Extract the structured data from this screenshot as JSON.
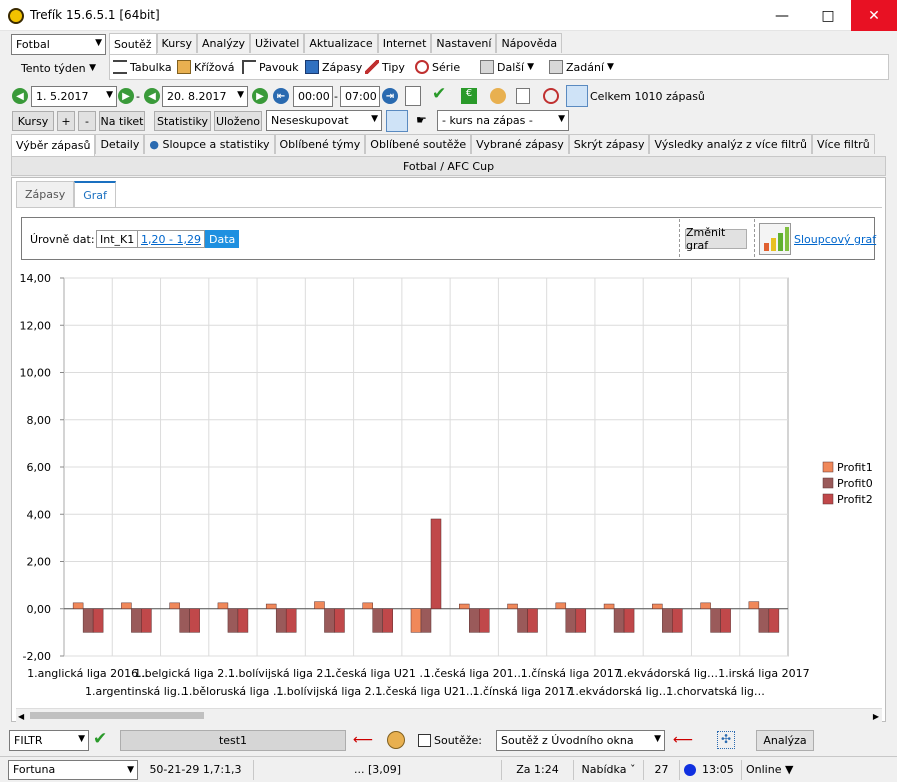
{
  "window": {
    "title": "Trefík 15.6.5.1 [64bit]"
  },
  "top": {
    "sport": "Fotbal",
    "period": "Tento týden",
    "menu_tabs": [
      "Soutěž",
      "Kursy",
      "Analýzy",
      "Uživatel",
      "Aktualizace",
      "Internet",
      "Nastavení",
      "Nápověda"
    ],
    "toolbar": [
      "Tabulka",
      "Křížová",
      "Pavouk",
      "Zápasy",
      "Tipy",
      "Série",
      "Další",
      "Zadání"
    ]
  },
  "filters": {
    "date_from": "1. 5.2017",
    "date_to": "20. 8.2017",
    "time_from": "00:00",
    "time_to": "07:00",
    "total": "Celkem 1010 zápasů",
    "buttons": [
      "Kursy",
      "+",
      "-",
      "Na tiket",
      "Statistiky",
      "Uloženo"
    ],
    "group_select": "Neseskupovat",
    "odds_select": "- kurs na zápas -"
  },
  "tabs": [
    "Výběr zápasů",
    "Detaily",
    "Sloupce a statistiky",
    "Oblíbené týmy",
    "Oblíbené soutěže",
    "Vybrané zápasy",
    "Skrýt zápasy",
    "Výsledky analýz z více filtrů",
    "Více filtrů"
  ],
  "section_title": "Fotbal / AFC Cup",
  "subtabs": [
    "Zápasy",
    "Graf"
  ],
  "levels": {
    "label": "Úrovně dat:",
    "crumbs": [
      "Int_K1",
      "1,20 - 1,29",
      "Data"
    ],
    "change_btn": "Změnit graf",
    "chart_link": "Sloupcový graf"
  },
  "chart_data": {
    "type": "bar",
    "ylim": [
      -2,
      14
    ],
    "yticks": [
      "14,00",
      "12,00",
      "10,00",
      "8,00",
      "6,00",
      "4,00",
      "2,00",
      "0,00",
      "-2,00"
    ],
    "ytick_values": [
      14,
      12,
      10,
      8,
      6,
      4,
      2,
      0,
      -2
    ],
    "categories": [
      "1.anglická liga 2016…",
      "1.argentinská lig…",
      "1.belgická liga 2…",
      "1.běloruská liga …",
      "1.bolívijská liga 2…",
      "1.bolívijská liga 2…",
      "1.česká liga U21 …",
      "1.česká liga U21…",
      "1.česká liga 201…",
      "1.čínská liga 2017",
      "1.čínská liga 2017",
      "1.ekvádorská lig…",
      "1.ekvádorská lig…",
      "1.chorvatská lig…",
      "1.irská liga 2017"
    ],
    "series": [
      {
        "name": "Profit1",
        "color": "#f0885a",
        "values": [
          0.25,
          0.25,
          0.25,
          0.25,
          0.2,
          0.3,
          0.25,
          -1,
          0.2,
          0.2,
          0.25,
          0.2,
          0.2,
          0.25,
          0.3
        ]
      },
      {
        "name": "Profit0",
        "color": "#9a5a5a",
        "values": [
          -1,
          -1,
          -1,
          -1,
          -1,
          -1,
          -1,
          -1,
          -1,
          -1,
          -1,
          -1,
          -1,
          -1,
          -1
        ]
      },
      {
        "name": "Profit2",
        "color": "#c0484a",
        "values": [
          -1,
          -1,
          -1,
          -1,
          -1,
          -1,
          -1,
          3.8,
          -1,
          -1,
          -1,
          -1,
          -1,
          -1,
          -1
        ]
      }
    ],
    "legend": "right"
  },
  "bottom": {
    "filter": "FILTR",
    "name": "test1",
    "competitions_label": "Soutěže:",
    "competitions_select": "Soutěž z Úvodního okna",
    "analysis": "Analýza"
  },
  "status": [
    "Fortuna",
    "50-21-29  1,7:1,3",
    "... [3,09]",
    "Za 1:24",
    "Nabídka ˇ",
    "27",
    "13:05",
    "Online ▼"
  ]
}
